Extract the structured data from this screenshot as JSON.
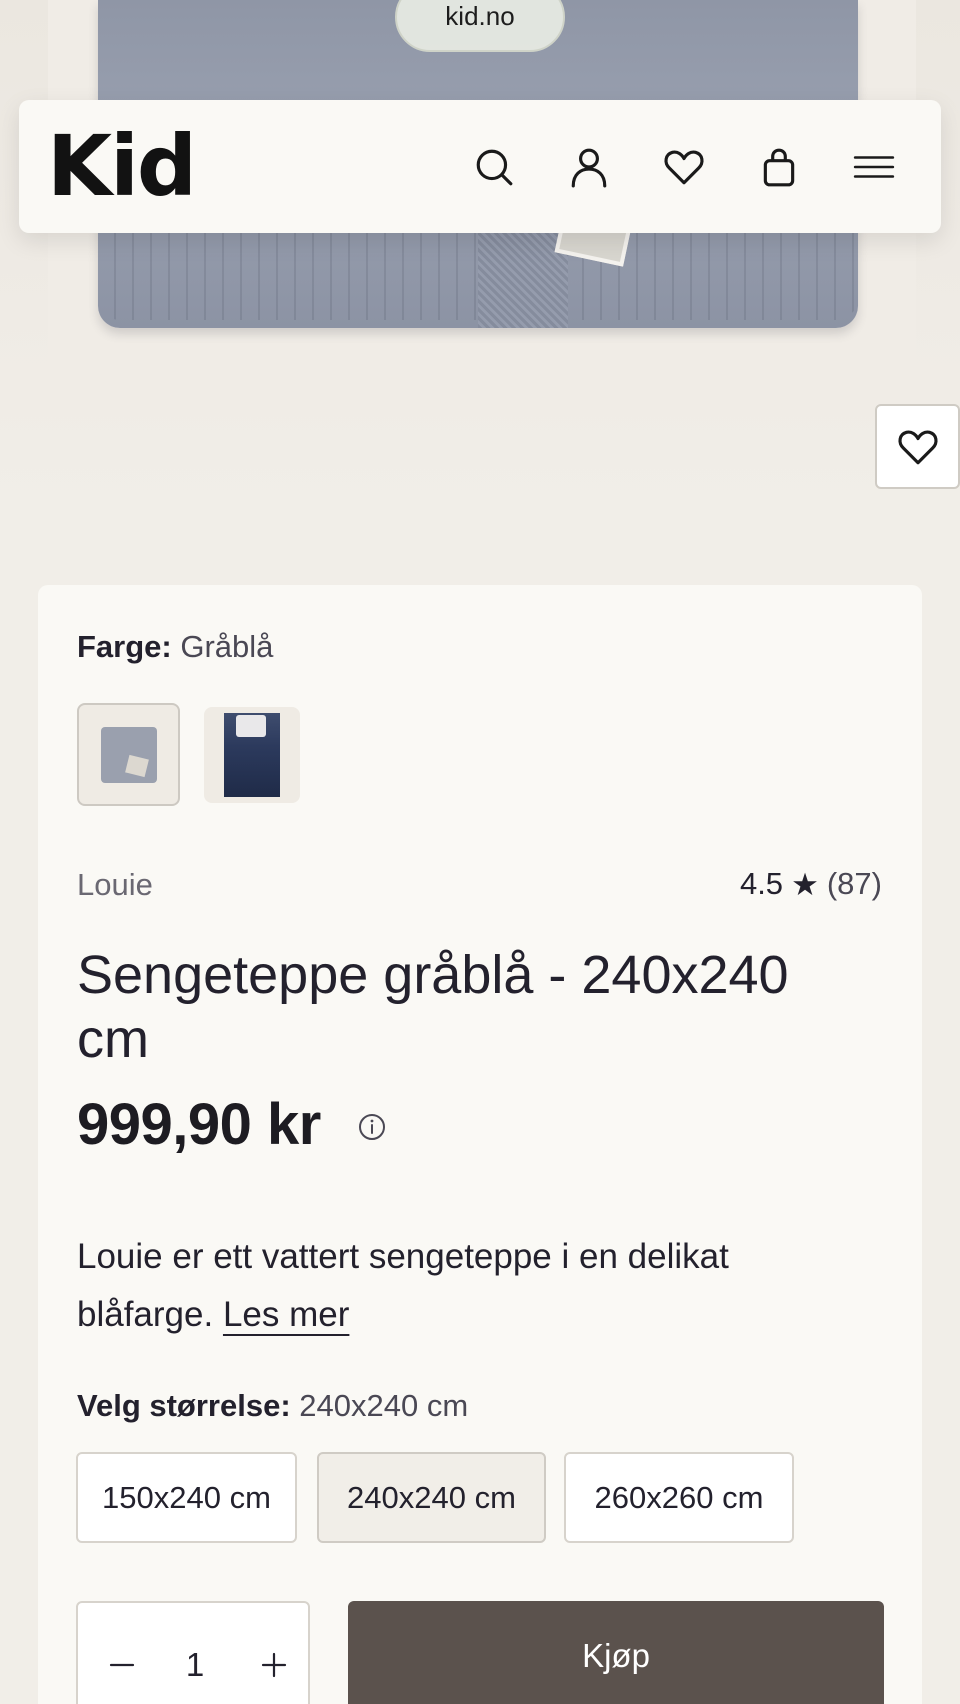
{
  "browser": {
    "url": "kid.no"
  },
  "header": {
    "logo": "Kid",
    "icons": [
      "search-icon",
      "user-icon",
      "heart-icon",
      "bag-icon",
      "menu-icon"
    ]
  },
  "product": {
    "color_label": "Farge:",
    "color_value": "Gråblå",
    "swatches": [
      "Gråblå",
      "Mørkeblå"
    ],
    "brand": "Louie",
    "rating": "4.5",
    "rating_star": "★",
    "review_count": "(87)",
    "title": "Sengeteppe gråblå - 240x240 cm",
    "price": "999,90 kr",
    "description": "Louie er ett vattert sengeteppe i en delikat blåfarge.",
    "read_more": "Les mer",
    "size_label": "Velg størrelse:",
    "size_value": "240x240 cm",
    "sizes": [
      "150x240 cm",
      "240x240 cm",
      "260x260 cm"
    ],
    "selected_size_index": 1,
    "quantity": "1",
    "buy_label": "Kjøp"
  },
  "colors": {
    "buy_button": "#5b524d",
    "card_background": "#faf9f5",
    "page_background": "#f1eee8",
    "text": "#23212d"
  }
}
